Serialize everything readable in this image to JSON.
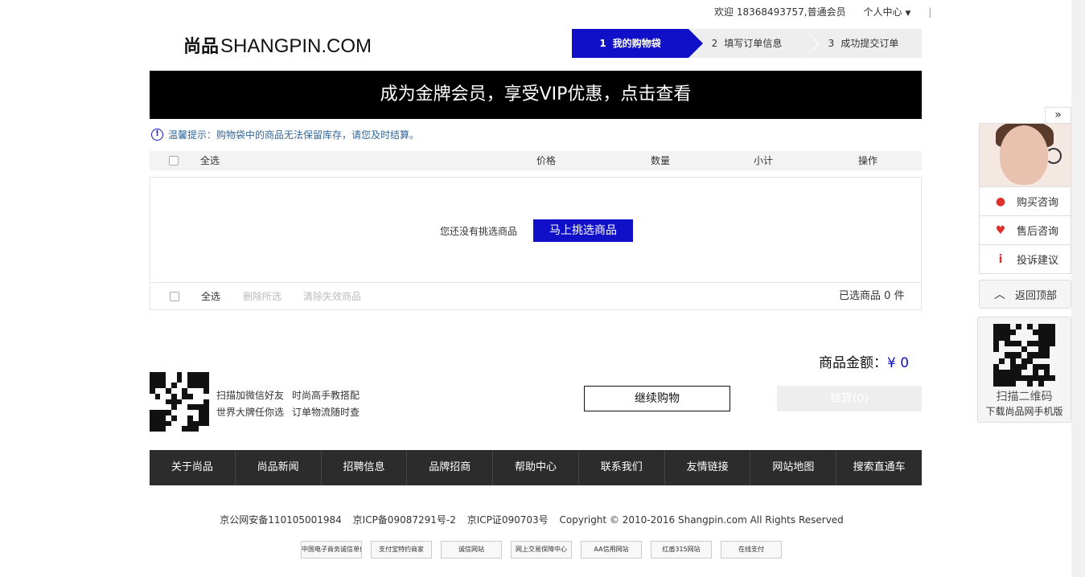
{
  "topbar": {
    "welcome": "欢迎 18368493757,普通会员",
    "personal_center": "个人中心",
    "sep": "|"
  },
  "logo": {
    "cn": "尚品",
    "en": "SHANGPIN.COM"
  },
  "steps": [
    {
      "num": "1",
      "label": "我的购物袋",
      "active": true
    },
    {
      "num": "2",
      "label": "填写订单信息",
      "active": false
    },
    {
      "num": "3",
      "label": "成功提交订单",
      "active": false
    }
  ],
  "banner": "成为金牌会员，享受VIP优惠，点击查看",
  "notice": "温馨提示：购物袋中的商品无法保留库存，请您及时结算。",
  "table_header": {
    "select_all": "全选",
    "price": "价格",
    "quantity": "数量",
    "subtotal": "小计",
    "action": "操作"
  },
  "empty_cart": {
    "text": "您还没有挑选商品",
    "button": "马上挑选商品"
  },
  "cart_footer": {
    "select_all": "全选",
    "delete_selected": "删除所选",
    "clear_invalid": "清除失效商品",
    "selected_label": "已选商品",
    "selected_count": "0",
    "unit": "件"
  },
  "amount": {
    "label": "商品金额：",
    "value": "¥ 0"
  },
  "promo": {
    "line1a": "扫描加微信好友",
    "line1b": "时尚高手教搭配",
    "line2a": "世界大牌任你选",
    "line2b": "订单物流随时查"
  },
  "buttons": {
    "continue": "继续购物",
    "checkout": "结算(0)"
  },
  "footer_nav": [
    "关于尚品",
    "尚品新闻",
    "招聘信息",
    "品牌招商",
    "帮助中心",
    "联系我们",
    "友情链接",
    "网站地图",
    "搜索直通车"
  ],
  "copyright": {
    "beian": "京公网安备110105001984",
    "icp": "京ICP备09087291号-2",
    "icp_license": "京ICP证090703号",
    "text": "Copyright © 2010-2016 Shangpin.com All Rights Reserved"
  },
  "badges": [
    "中国电子商务诚信单位",
    "支付宝特约商家",
    "诚信网站",
    "网上交易保障中心",
    "AA信用网站",
    "红盾315网站",
    "在线支付"
  ],
  "side_panel": {
    "toggle": "»",
    "items": [
      "购买咨询",
      "售后咨询",
      "投诉建议"
    ],
    "back_top": "返回顶部",
    "qr_line1": "扫描二维码",
    "qr_line2": "下载尚品网手机版"
  },
  "colors": {
    "accent": "#1010c8",
    "banner_bg": "#000000",
    "footer_bg": "#2c2c2c"
  }
}
